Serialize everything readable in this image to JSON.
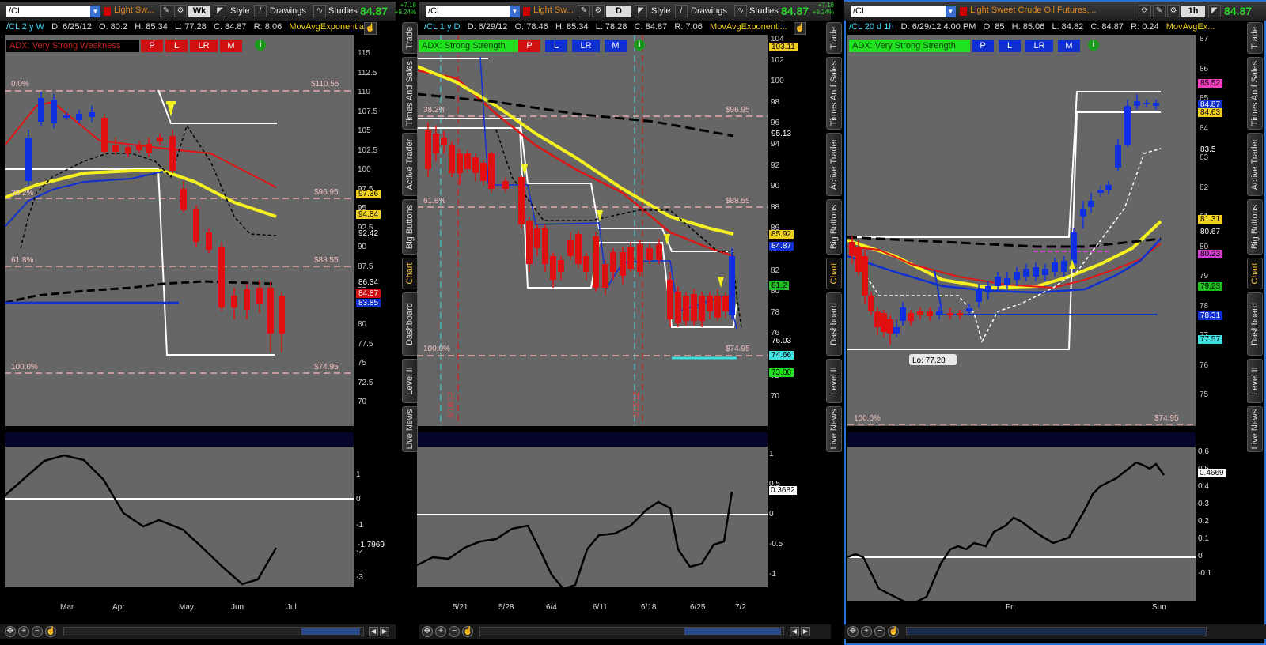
{
  "panels": [
    {
      "symbol": "/CL",
      "description": "Light Sw...",
      "aggregation": "Wk",
      "style_label": "Style",
      "drawings_label": "Drawings",
      "studies_label": "Studies",
      "last_price": "84.87",
      "change": "+7.18",
      "change_pct": "+9.24%",
      "info": {
        "sym": "/CL 2 y W",
        "date": "D: 6/25/12",
        "open": "O: 80.2",
        "high": "H: 85.34",
        "low": "L: 77.28",
        "close": "C: 84.87",
        "range": "R: 8.06",
        "study": "MovAvgExponentia..."
      },
      "adx": {
        "label": "ADX:  Very Strong Weakness",
        "color": "#cc1111",
        "text_color": "#e8e8e8"
      },
      "fib": [
        {
          "label": "0.0%",
          "price": "$110.55"
        },
        {
          "label": "38.2%",
          "price": "$96.95"
        },
        {
          "label": "61.8%",
          "price": "$88.55"
        },
        {
          "label": "100.0%",
          "price": "$74.95"
        }
      ],
      "price_axis": [
        "115",
        "112.5",
        "110",
        "107.5",
        "105",
        "102.5",
        "100",
        "97.5",
        "95",
        "92.5",
        "90",
        "87.5",
        "85",
        "82.5",
        "80",
        "77.5",
        "75",
        "72.5",
        "70"
      ],
      "price_tags": [
        {
          "value": "97.36",
          "bg": "#f0d020",
          "fg": "#000"
        },
        {
          "value": "94.84",
          "bg": "#f0d020",
          "fg": "#000"
        },
        {
          "value": "92.42",
          "bg": "#000",
          "fg": "#fff"
        },
        {
          "value": "86.34",
          "bg": "#000",
          "fg": "#fff"
        },
        {
          "value": "84.87",
          "bg": "#d01010",
          "fg": "#fff"
        },
        {
          "value": "83.85",
          "bg": "#1030d0",
          "fg": "#fff"
        }
      ],
      "osc_axis": [
        "1",
        "0",
        "-1",
        "-2",
        "-3"
      ],
      "osc_tag": "-1.7969",
      "time_axis": [
        "Mar",
        "Apr",
        "May",
        "Jun",
        "Jul"
      ]
    },
    {
      "symbol": "/CL",
      "description": "Light Sw...",
      "aggregation": "D",
      "style_label": "Style",
      "drawings_label": "Drawings",
      "studies_label": "Studies",
      "last_price": "84.87",
      "change": "+7.18",
      "change_pct": "+9.24%",
      "info": {
        "sym": "/CL 1 y D",
        "date": "D: 6/29/12",
        "open": "O: 78.46",
        "high": "H: 85.34",
        "low": "L: 78.28",
        "close": "C: 84.87",
        "range": "R: 7.06",
        "study": "MovAvgExponenti..."
      },
      "adx": {
        "label": "ADX:  Strong Strength",
        "color": "#20e020",
        "text_color": "#0a3a0a"
      },
      "fib": [
        {
          "label": "38.2%",
          "price": "$96.95"
        },
        {
          "label": "61.8%",
          "price": "$88.55"
        },
        {
          "label": "100.0%",
          "price": "$74.95"
        }
      ],
      "price_axis": [
        "104",
        "102",
        "100",
        "98",
        "96",
        "94",
        "92",
        "90",
        "88",
        "86",
        "84",
        "82",
        "80",
        "78",
        "76",
        "74",
        "72",
        "70"
      ],
      "price_tags": [
        {
          "value": "103.11",
          "bg": "#f0d020",
          "fg": "#000"
        },
        {
          "value": "95.13",
          "bg": "#000",
          "fg": "#fff"
        },
        {
          "value": "85.92",
          "bg": "#f0d020",
          "fg": "#000"
        },
        {
          "value": "84.87",
          "bg": "#1030d0",
          "fg": "#fff"
        },
        {
          "value": "81.2",
          "bg": "#20c020",
          "fg": "#000"
        },
        {
          "value": "76.03",
          "bg": "#000",
          "fg": "#fff"
        },
        {
          "value": "74.66",
          "bg": "#40e0e0",
          "fg": "#000"
        },
        {
          "value": "73.08",
          "bg": "#20e020",
          "fg": "#000"
        }
      ],
      "date_markers": [
        "5/18/12",
        "6/15/12"
      ],
      "osc_axis": [
        "1",
        "0.5",
        "0",
        "-0.5",
        "-1"
      ],
      "osc_tag": "0.3682",
      "time_axis": [
        "5/21",
        "5/28",
        "6/4",
        "6/11",
        "6/18",
        "6/25",
        "7/2"
      ]
    },
    {
      "symbol": "/CL",
      "description": "Light Sweet Crude Oil Futures,...",
      "aggregation": "1h",
      "last_price": "84.87",
      "change": "+7.18",
      "change_pct": "+9.24%",
      "info": {
        "sym": "/CL 20 d 1h",
        "date": "D: 6/29/12 4:00 PM",
        "open": "O: 85",
        "high": "H: 85.06",
        "low": "L: 84.82",
        "close": "C: 84.87",
        "range": "R: 0.24",
        "study": "MovAvgEx..."
      },
      "adx": {
        "label": "ADX:  Very Strong Strength",
        "color": "#20e020",
        "text_color": "#0a3a0a"
      },
      "fib": [
        {
          "label": "100.0%",
          "price": "$74.95"
        }
      ],
      "low_label": "Lo: 77.28",
      "price_axis": [
        "87",
        "86",
        "85",
        "84",
        "83",
        "82",
        "81",
        "80",
        "79",
        "78",
        "77",
        "76",
        "75"
      ],
      "price_tags": [
        {
          "value": "85.52",
          "bg": "#f040c0",
          "fg": "#000"
        },
        {
          "value": "84.87",
          "bg": "#1030d0",
          "fg": "#fff"
        },
        {
          "value": "84.63",
          "bg": "#f0d020",
          "fg": "#000"
        },
        {
          "value": "83.5",
          "bg": "#000",
          "fg": "#fff"
        },
        {
          "value": "81.31",
          "bg": "#f0d020",
          "fg": "#000"
        },
        {
          "value": "80.67",
          "bg": "#000",
          "fg": "#fff"
        },
        {
          "value": "80.23",
          "bg": "#d040d0",
          "fg": "#000"
        },
        {
          "value": "79.23",
          "bg": "#20c020",
          "fg": "#000"
        },
        {
          "value": "78.31",
          "bg": "#1030d0",
          "fg": "#fff"
        },
        {
          "value": "77.57",
          "bg": "#40e0e0",
          "fg": "#000"
        }
      ],
      "osc_axis": [
        "0.6",
        "0.5",
        "0.4",
        "0.3",
        "0.2",
        "0.1",
        "0",
        "-0.1"
      ],
      "osc_tag": "0.4669",
      "time_axis": [
        "Fri",
        "Sun"
      ]
    }
  ],
  "adx_buttons": [
    "P",
    "L",
    "LR",
    "M"
  ],
  "side_tabs": [
    "Trade",
    "Times And Sales",
    "Active Trader",
    "Big Buttons",
    "Chart",
    "Dashboard",
    "Level II",
    "Live News"
  ],
  "colors": {
    "bull": "#1030e0",
    "bear": "#e01010",
    "ema_yellow": "#f5f020",
    "ema_red": "#e01515",
    "ema_blue": "#1030d0",
    "fib_line": "#e8a8a8",
    "chart_bg": "#666666"
  }
}
